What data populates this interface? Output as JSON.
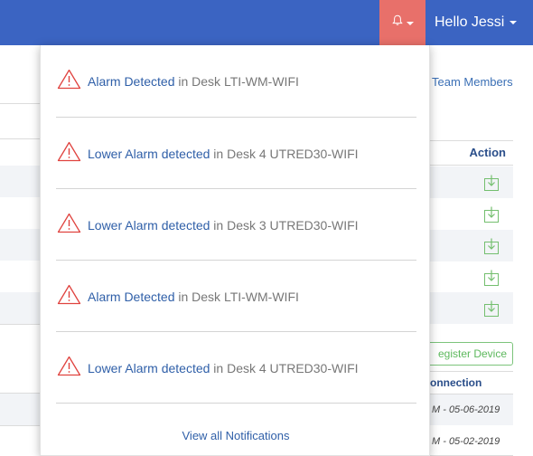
{
  "navbar": {
    "greeting": "Hello Jessi",
    "bell_icon": "bell-icon",
    "colors": {
      "bar": "#3b64c2",
      "bell_active": "#e8706a"
    }
  },
  "background": {
    "team_members_label": "Team Members",
    "action_header": "Action",
    "action_icon": "download-icon",
    "register_button": "egister Device",
    "connection_header": "onnection",
    "connection_rows": [
      "M - 05-06-2019",
      "M - 05-02-2019"
    ]
  },
  "notifications": {
    "warning_icon": "warning-icon",
    "items": [
      {
        "title": "Alarm Detected",
        "detail": " in Desk LTI-WM-WIFI"
      },
      {
        "title": "Lower Alarm detected",
        "detail": " in Desk 4 UTRED30-WIFI"
      },
      {
        "title": "Lower Alarm detected",
        "detail": " in Desk 3 UTRED30-WIFI"
      },
      {
        "title": "Alarm Detected",
        "detail": " in Desk LTI-WM-WIFI"
      },
      {
        "title": "Lower Alarm detected",
        "detail": " in Desk 4 UTRED30-WIFI"
      }
    ],
    "view_all": "View all Notifications"
  }
}
